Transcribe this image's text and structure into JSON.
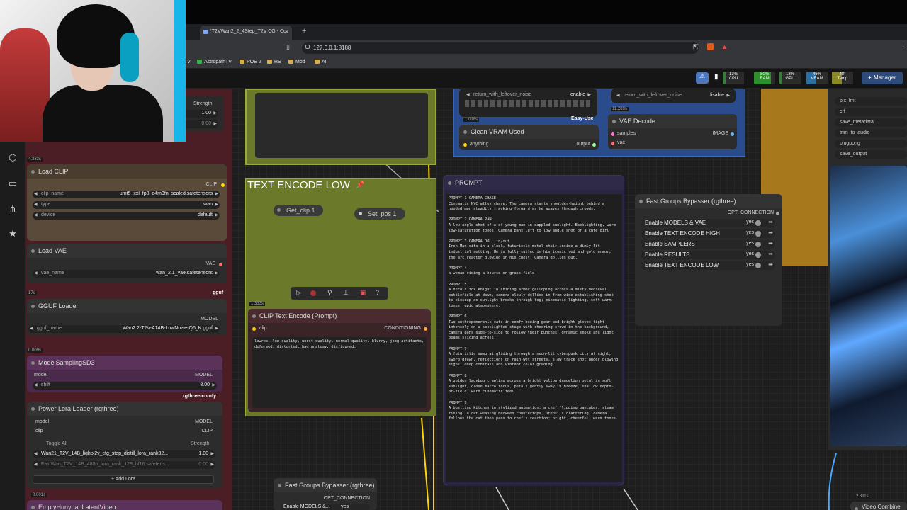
{
  "browser": {
    "tab_title": "*T2VWan2_2_4Step_T2V CG - Co",
    "url": "127.0.0.1:8188",
    "bookmarks": [
      "TV",
      "AstropathTV",
      "POE 2",
      "RS",
      "Mod",
      "AI"
    ]
  },
  "topbar": {
    "stats": [
      {
        "label": "CPU",
        "value": "13%",
        "color": "#3a7a3a",
        "level": 0.13
      },
      {
        "label": "RAM",
        "value": "80%",
        "color": "#2f8f2f",
        "level": 0.8
      },
      {
        "label": "GPU",
        "value": "13%",
        "color": "#3a7a3a",
        "level": 0.13
      },
      {
        "label": "VRAM",
        "value": "46%",
        "color": "#2f6fa0",
        "level": 0.46
      },
      {
        "label": "Temp",
        "value": "48°",
        "color": "#8a8a2a",
        "level": 0.48
      }
    ],
    "manager_label": "Manager"
  },
  "sidebar": {
    "icons": [
      "cube-icon",
      "folder-icon",
      "nodes-icon",
      "star-icon"
    ]
  },
  "nodes": {
    "strength_top": {
      "label": "Strength",
      "val1": "1.00",
      "val2": "0.00"
    },
    "load_clip": {
      "title": "Load CLIP",
      "time": "4.333s",
      "output": "CLIP",
      "clip_name_label": "clip_name",
      "clip_name": "umt5_xxl_fp8_e4m3fn_scaled.safetensors",
      "type_label": "type",
      "type": "wan",
      "device_label": "device",
      "device": "default"
    },
    "load_vae": {
      "title": "Load VAE",
      "output": "VAE",
      "vae_name_label": "vae_name",
      "vae_name": "wan_2.1_vae.safetensors",
      "badge": "gguf",
      "time": "17s"
    },
    "gguf_loader": {
      "title": "GGUF Loader",
      "output": "MODEL",
      "gguf_name_label": "gguf_name",
      "gguf_name": "Wan2.2-T2V-A14B-LowNoise-Q6_K.gguf",
      "time": "0.009s"
    },
    "model_sampling": {
      "title": "ModelSamplingSD3",
      "input": "model",
      "output": "MODEL",
      "shift_label": "shift",
      "shift": "8.00",
      "badge": "rgthree-comfy"
    },
    "power_lora": {
      "title": "Power Lora Loader (rgthree)",
      "in_model": "model",
      "in_clip": "clip",
      "out_model": "MODEL",
      "out_clip": "CLIP",
      "toggle_all": "Toggle All",
      "strength_label": "Strength",
      "lora1": "Wan21_T2V_14B_lightx2v_cfg_step_distill_lora_rank32...",
      "lora1_val": "1.00",
      "lora2": "FastWan_T2V_14B_480p_lora_rank_128_bf16.safetens...",
      "lora2_val": "0.00",
      "add_lora": "Add Lora",
      "time": "0.001s"
    },
    "empty_latent": {
      "title": "EmptyHunyuanLatentVideo"
    },
    "text_encode_low": {
      "title": "TEXT ENCODE LOW",
      "get_clip": "Get_clip 1",
      "set_pos": "Set_pos 1"
    },
    "clip_text_encode": {
      "title": "CLIP Text Encode (Prompt)",
      "input": "clip",
      "output": "CONDITIONING",
      "time": "1.333s",
      "text": "lowres, low quality, worst quality, normal quality, blurry, jpeg artifacts, deformed, distorted, bad anatomy, disfigured,"
    },
    "prompt": {
      "title": "PROMPT",
      "text": "PROMPT 1 CAMERA CHASE\nCinematic NYC alley chase: The camera starts shoulder-height behind a hooded man steadily tracking forward as he weaves through crowds.\n\nPROMPT 2 CAMERA PAN\nA low angle shot of a of young man in dappled sunlight. Backlighting, warm low-saturation tones. Camera pans left to low angle shot of a cute girl\n\nPROMPT 3 CAMERA DOLL in/out\nIron Man sits in a sleek, futuristic metal chair inside a dimly lit industrial setting. He is fully suited in his iconic red and gold armor, the arc reactor glowing in his chest. Camera dollies out.\n\nPROMPT 4\na woman riding a hourse on grass field\n\nPROMPT 5\nA heroic fox knight in shining armor galloping across a misty medieval battlefield at dawn, camera slowly dollies in from wide establishing shot to closeup as sunlight breaks through fog; cinematic lighting, soft warm tones, epic atmosphere.\n\nPROMPT 6\nTwo anthropomorphic cats in comfy boxing gear and bright gloves fight intensely on a spotlighted stage with cheering crowd in the background, camera pans side-to-side to follow their punches, dynamic smoke and light beams slicing across.\n\nPROMPT 7\nA futuristic samurai gliding through a neon-lit cyberpunk city at night, sword drawn, reflections on rain-wet streets, slow track shot under glowing signs, deep contrast and vibrant color grading.\n\nPROMPT 8\nA golden ladybug crawling across a bright yellow dandelion petal in soft sunlight, close macro focus, petals gently sway in breeze, shallow depth-of-field, warm cinematic feel.\n\nPROMPT 9\nA bustling kitchen in stylized animation: a chef flipping pancakes, steam rising, a cat weaving between countertops, utensils clattering; camera follows the cat then pans to chef's reaction; bright, cheerful, warm tones."
    },
    "sampler_top": {
      "return_label": "return_with_leftover_noise",
      "return_val": "enable",
      "badge": "Easy-Use"
    },
    "clean_vram": {
      "title": "Clean VRAM Used",
      "input": "anything",
      "output": "output",
      "time": "1.018s"
    },
    "sampler_top2": {
      "return_label": "return_with_leftover_noise",
      "return_val": "disable"
    },
    "vae_decode": {
      "title": "VAE Decode",
      "in_samples": "samples",
      "in_vae": "vae",
      "output": "IMAGE",
      "time": "11.289s"
    },
    "fast_bypasser": {
      "title": "Fast Groups Bypasser (rgthree)",
      "output": "OPT_CONNECTION",
      "rows": [
        {
          "label": "Enable MODELS & VAE",
          "value": "yes"
        },
        {
          "label": "Enable TEXT ENCODE HIGH",
          "value": "yes"
        },
        {
          "label": "Enable SAMPLERS",
          "value": "yes"
        },
        {
          "label": "Enable RESULTS",
          "value": "yes"
        },
        {
          "label": "Enable TEXT ENCODE LOW",
          "value": "yes"
        }
      ]
    },
    "fast_bypasser2": {
      "title": "Fast Groups Bypasser (rgthree)",
      "output": "OPT_CONNECTION",
      "row": "Enable MODELS &...",
      "value": "yes"
    },
    "video_combine": {
      "items": [
        "pix_fmt",
        "crf",
        "save_metadata",
        "trim_to_audio",
        "pingpong",
        "save_output"
      ],
      "time": "2.311s",
      "title": "Video Combine"
    }
  }
}
